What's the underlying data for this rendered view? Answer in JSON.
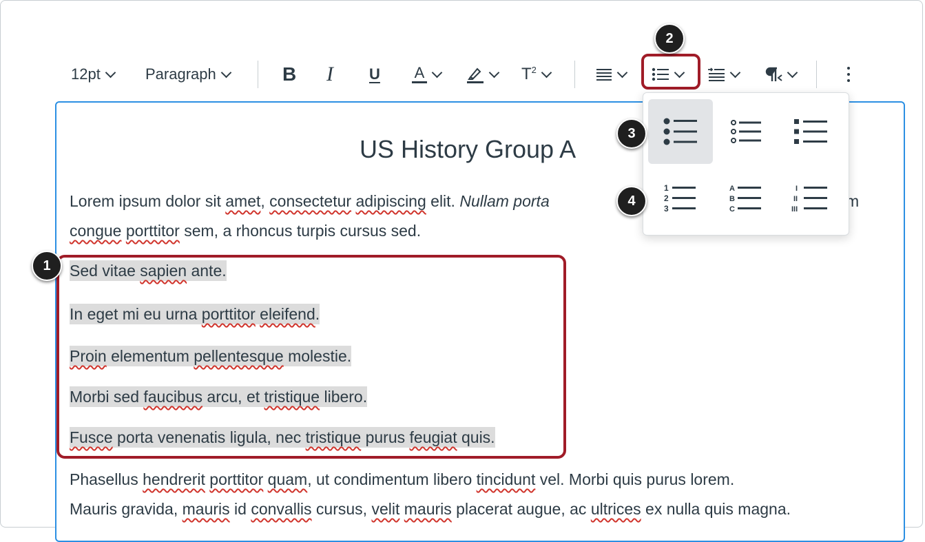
{
  "toolbar": {
    "font_size": "12pt",
    "block_format": "Paragraph",
    "bold": "B",
    "italic": "I",
    "underline": "U",
    "text_color": "A",
    "superscript": "T",
    "superscript_mark": "2",
    "icons": [
      "align-icon",
      "bullet-list-icon",
      "indent-icon",
      "paragraph-direction-icon",
      "more-icon"
    ]
  },
  "list_menu": {
    "unordered": [
      "bullet-disc-list-icon",
      "bullet-circle-list-icon",
      "bullet-square-list-icon"
    ],
    "ordered": [
      "numbered-list-icon",
      "lettered-list-icon",
      "roman-numeral-list-icon"
    ],
    "selected": "bullet-disc-list-icon"
  },
  "badges": [
    "1",
    "2",
    "3",
    "4"
  ],
  "document": {
    "title": "US History Group A",
    "intro_line1": {
      "a": "Lorem ipsum dolor sit ",
      "b": "amet",
      "c": ", ",
      "d": "consectetur",
      "e": " ",
      "f": "adipiscing",
      "g": " elit. ",
      "h": "Nullam porta",
      "i": "m"
    },
    "intro_line2": {
      "a": "congue",
      "b": " ",
      "c": "porttitor",
      "d": " sem, a rhoncus turpis cursus sed."
    },
    "list_items": [
      {
        "a": "Sed vitae ",
        "b": "sapien",
        "c": " ante.",
        "d": "",
        "e": ""
      },
      {
        "a": "In eget mi eu urna ",
        "b": "porttitor",
        "c": " ",
        "d": "eleifend",
        "e": "."
      },
      {
        "a": "",
        "b": "Proin",
        "c": " elementum ",
        "d": "pellentesque",
        "e": " molestie."
      },
      {
        "a": "Morbi sed ",
        "b": "faucibus",
        "c": " arcu, et ",
        "d": "tristique",
        "e": " libero."
      },
      {
        "a": "",
        "b": "Fusce",
        "c": " porta venenatis ligula, nec ",
        "d": "tristique",
        "e": " purus ",
        "f": "feugiat",
        "g": " quis."
      }
    ],
    "outro_line1": {
      "a": "Phasellus ",
      "b": "hendrerit",
      "c": " ",
      "d": "porttitor",
      "e": " ",
      "f": "quam",
      "g": ", ut condimentum libero ",
      "h": "tincidunt",
      "i": " vel. Morbi quis purus lorem."
    },
    "outro_line2": {
      "a": "Mauris gravida, ",
      "b": "mauris",
      "c": " id ",
      "d": "convallis",
      "e": " cursus, ",
      "f": "velit",
      "g": " ",
      "h": "mauris",
      "i": " placerat augue, ac ",
      "j": "ultrices",
      "k": " ex nulla quis magna."
    }
  },
  "colors": {
    "annotation": "#a01c28",
    "focus": "#2b8fe3",
    "selection": "#dcdcdc",
    "spellcheck": "#d0342c"
  }
}
